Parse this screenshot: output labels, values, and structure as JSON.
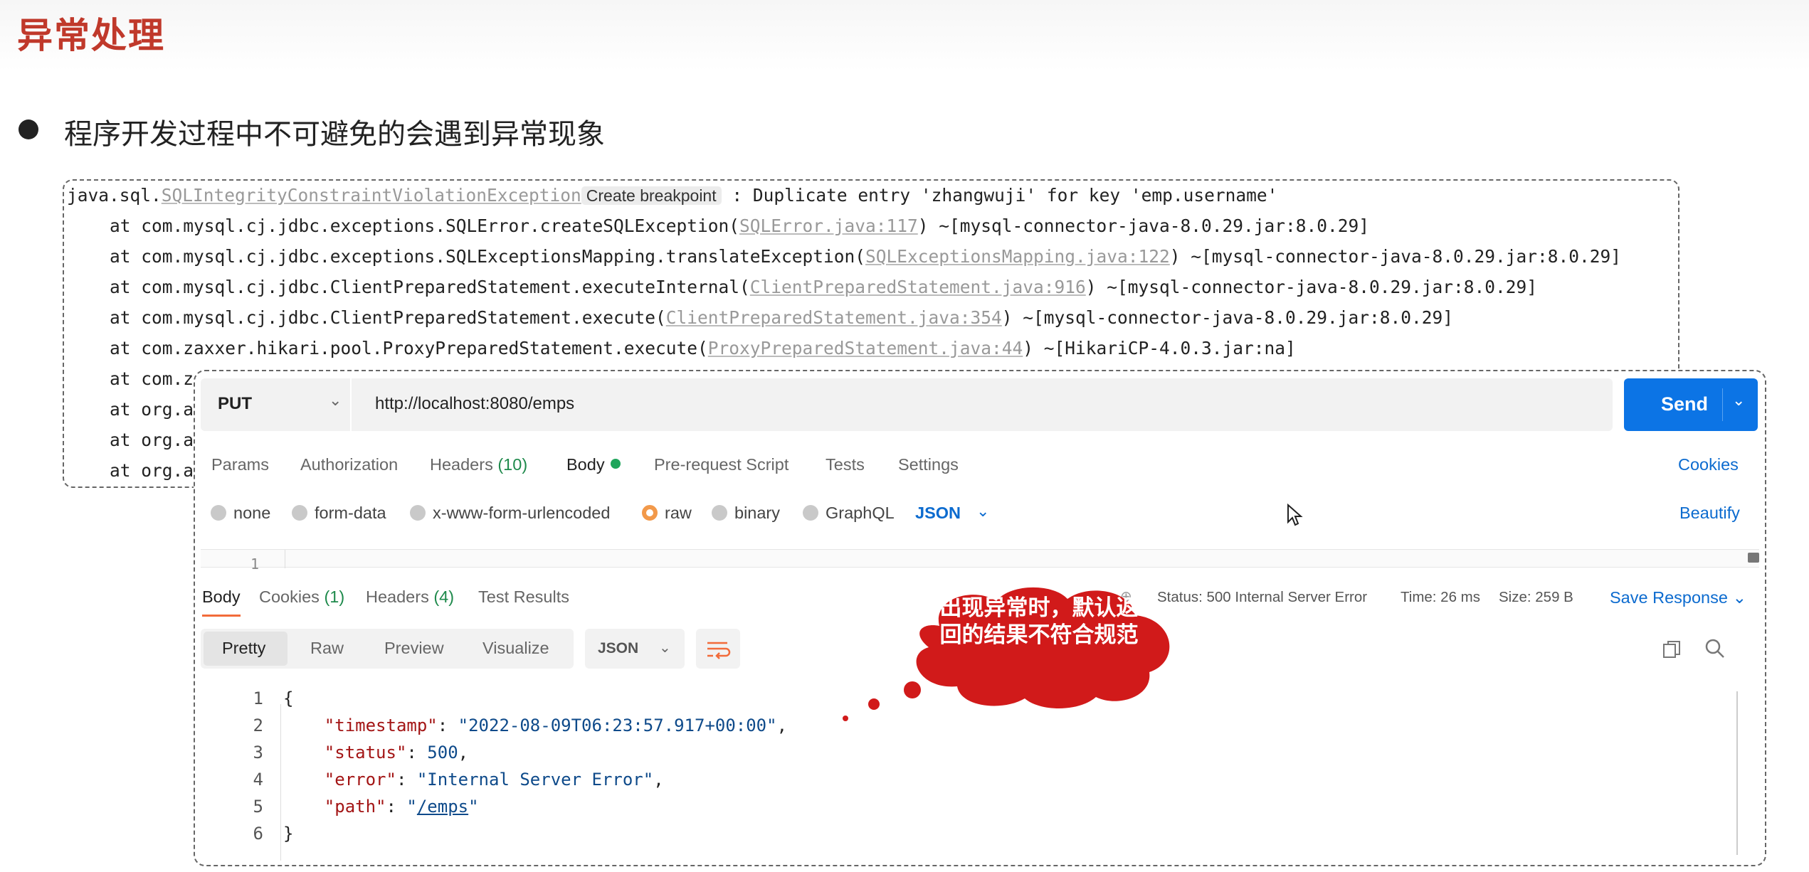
{
  "slide": {
    "title": "异常处理",
    "bullet": "程序开发过程中不可避免的会遇到异常现象"
  },
  "trace": {
    "line0_prefix": "java.sql.",
    "line0_exception": "SQLIntegrityConstraintViolationException",
    "line0_breakpoint": "Create breakpoint",
    "line0_suffix": " : Duplicate entry 'zhangwuji' for key 'emp.username'",
    "lines": [
      {
        "pre": "at com.mysql.cj.jdbc.exceptions.SQLError.createSQLException(",
        "link": "SQLError.java:117",
        "post": ") ~[mysql-connector-java-8.0.29.jar:8.0.29]"
      },
      {
        "pre": "at com.mysql.cj.jdbc.exceptions.SQLExceptionsMapping.translateException(",
        "link": "SQLExceptionsMapping.java:122",
        "post": ") ~[mysql-connector-java-8.0.29.jar:8.0.29]"
      },
      {
        "pre": "at com.mysql.cj.jdbc.ClientPreparedStatement.executeInternal(",
        "link": "ClientPreparedStatement.java:916",
        "post": ") ~[mysql-connector-java-8.0.29.jar:8.0.29]"
      },
      {
        "pre": "at com.mysql.cj.jdbc.ClientPreparedStatement.execute(",
        "link": "ClientPreparedStatement.java:354",
        "post": ") ~[mysql-connector-java-8.0.29.jar:8.0.29]"
      },
      {
        "pre": "at com.zaxxer.hikari.pool.ProxyPreparedStatement.execute(",
        "link": "ProxyPreparedStatement.java:44",
        "post": ") ~[HikariCP-4.0.3.jar:na]"
      },
      {
        "pre": "at com.z",
        "link": "",
        "post": ""
      },
      {
        "pre": "at org.a",
        "link": "",
        "post": ""
      },
      {
        "pre": "at org.a",
        "link": "",
        "post": ""
      },
      {
        "pre": "at org.a",
        "link": "",
        "post": ""
      }
    ]
  },
  "request": {
    "method": "PUT",
    "url": "http://localhost:8080/emps",
    "send_label": "Send",
    "tabs": {
      "params": "Params",
      "authorization": "Authorization",
      "headers": "Headers",
      "headers_count": "(10)",
      "body": "Body",
      "prerequest": "Pre-request Script",
      "tests": "Tests",
      "settings": "Settings"
    },
    "cookies_label": "Cookies",
    "body_types": {
      "none": "none",
      "form_data": "form-data",
      "urlencoded": "x-www-form-urlencoded",
      "raw": "raw",
      "binary": "binary",
      "graphql": "GraphQL"
    },
    "format": "JSON",
    "beautify_label": "Beautify",
    "editor_line": "1"
  },
  "response": {
    "tabs": {
      "body": "Body",
      "cookies": "Cookies",
      "cookies_count": "(1)",
      "headers": "Headers",
      "headers_count": "(4)",
      "test_results": "Test Results"
    },
    "status": "Status: 500 Internal Server Error",
    "time": "Time: 26 ms",
    "size": "Size: 259 B",
    "save_label": "Save Response",
    "views": {
      "pretty": "Pretty",
      "raw": "Raw",
      "preview": "Preview",
      "visualize": "Visualize"
    },
    "format": "JSON",
    "code": {
      "open": "{",
      "close": "}",
      "k_timestamp": "\"timestamp\"",
      "v_timestamp": "\"2022-08-09T06:23:57.917+00:00\"",
      "k_status": "\"status\"",
      "v_status": "500",
      "k_error": "\"error\"",
      "v_error": "\"Internal Server Error\"",
      "k_path": "\"path\"",
      "v_path": "/emps"
    },
    "line_numbers": [
      "1",
      "2",
      "3",
      "4",
      "5",
      "6"
    ]
  },
  "callout": {
    "text": "出现异常时，默认返回的结果不符合规范",
    "color": "#d11a1a"
  }
}
